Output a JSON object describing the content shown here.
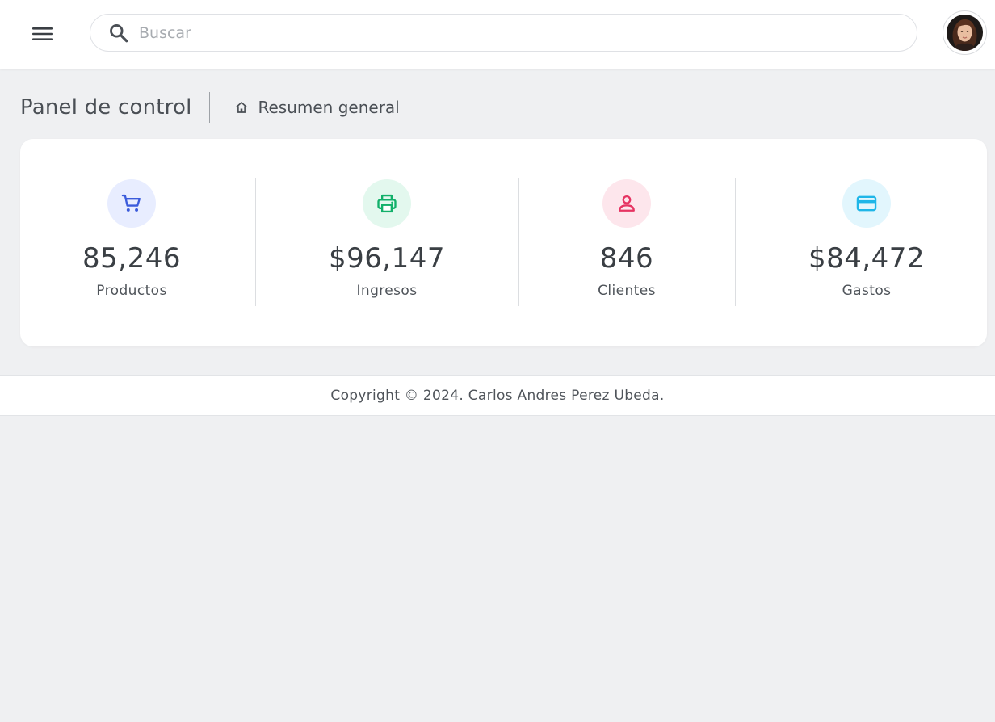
{
  "header": {
    "search_placeholder": "Buscar",
    "search_value": ""
  },
  "page": {
    "title": "Panel de control",
    "breadcrumb": "Resumen general"
  },
  "stats": [
    {
      "value": "85,246",
      "label": "Productos",
      "icon": "shopping-cart-icon",
      "color": "#3b5bdb",
      "bg": "#e8edff"
    },
    {
      "value": "$96,147",
      "label": "Ingresos",
      "icon": "printer-icon",
      "color": "#12b06a",
      "bg": "#e3f8ee"
    },
    {
      "value": "846",
      "label": "Clientes",
      "icon": "user-icon",
      "color": "#e63462",
      "bg": "#fde6ec"
    },
    {
      "value": "$84,472",
      "label": "Gastos",
      "icon": "credit-card-icon",
      "color": "#1fb6e8",
      "bg": "#e2f6fd"
    }
  ],
  "footer": {
    "copyright": "Copyright © 2024. Carlos Andres Perez Ubeda."
  }
}
